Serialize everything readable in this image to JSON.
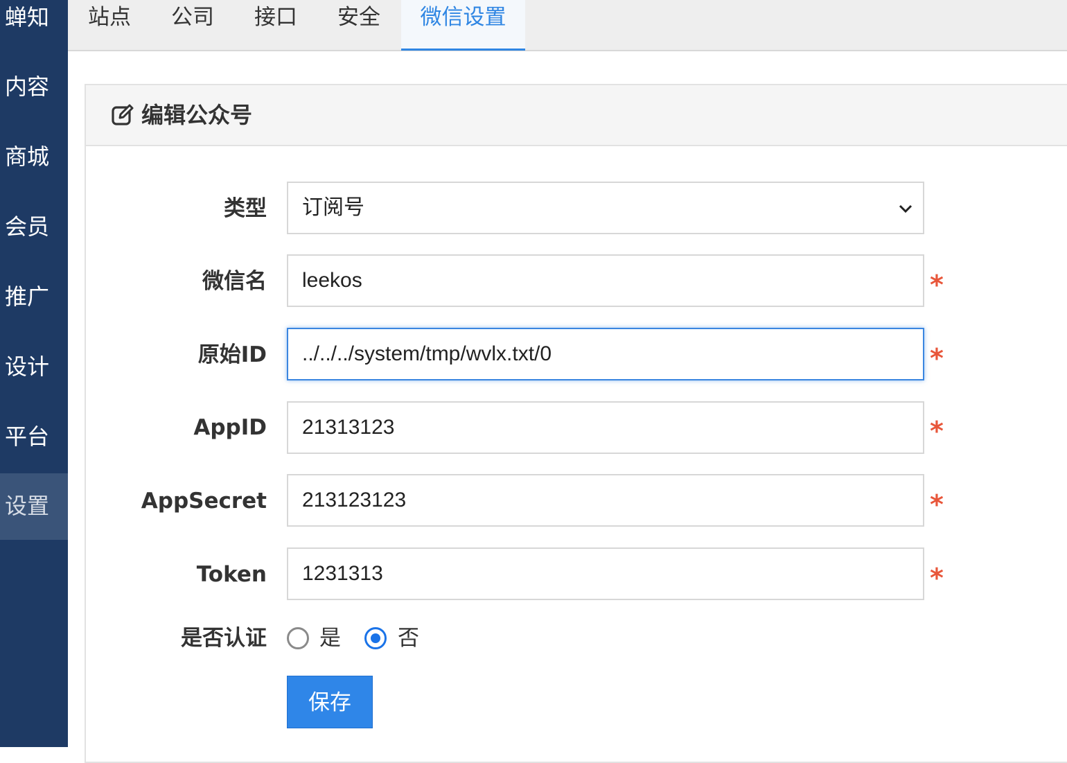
{
  "sidebar": {
    "brand": "蝉知",
    "items": [
      {
        "label": "内容"
      },
      {
        "label": "商城"
      },
      {
        "label": "会员"
      },
      {
        "label": "推广"
      },
      {
        "label": "设计"
      },
      {
        "label": "平台"
      },
      {
        "label": "设置",
        "active": true
      }
    ]
  },
  "tabs": [
    {
      "label": "站点"
    },
    {
      "label": "公司"
    },
    {
      "label": "接口"
    },
    {
      "label": "安全"
    },
    {
      "label": "微信设置",
      "active": true
    }
  ],
  "panel": {
    "icon": "edit-icon",
    "title": "编辑公众号"
  },
  "form": {
    "type": {
      "label": "类型",
      "value": "订阅号"
    },
    "wechat_name": {
      "label": "微信名",
      "value": "leekos"
    },
    "original_id": {
      "label": "原始ID",
      "value": "../../../system/tmp/wvlx.txt/0"
    },
    "app_id": {
      "label": "AppID",
      "value": "21313123"
    },
    "app_secret": {
      "label": "AppSecret",
      "value": "213123123"
    },
    "token": {
      "label": "Token",
      "value": "1231313"
    },
    "certified": {
      "label": "是否认证",
      "options": [
        {
          "label": "是",
          "selected": false
        },
        {
          "label": "否",
          "selected": true
        }
      ]
    },
    "required_mark": "*",
    "save_label": "保存"
  },
  "colors": {
    "sidebar_bg": "#1e3a64",
    "accent": "#2f86e3",
    "required": "#e8563a"
  }
}
